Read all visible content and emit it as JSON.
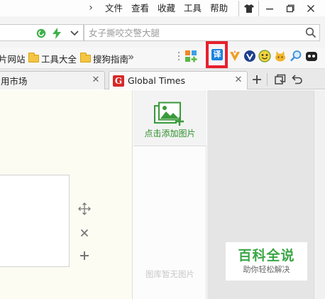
{
  "menubar": {
    "items": [
      "文件",
      "查看",
      "收藏",
      "工具",
      "帮助"
    ]
  },
  "address": {
    "search_placeholder": "女子撕咬交警大腿"
  },
  "bookmarks": {
    "items": [
      "片网站",
      "工具大全",
      "搜狗指南"
    ],
    "more": "»"
  },
  "tabs": [
    {
      "title": "用市场"
    },
    {
      "title": "Global Times",
      "favicon": "G"
    }
  ],
  "translate": {
    "glyph": "译"
  },
  "image_panel": {
    "add_label": "点击添加图片",
    "empty_label": "图库暂无图片"
  },
  "watermark": {
    "title": "百科全说",
    "subtitle": "助你轻松解决"
  },
  "colors": {
    "highlight": "#e8202e",
    "accent_green": "#2c8f2c",
    "tab_favicon": "#d62a2a"
  }
}
